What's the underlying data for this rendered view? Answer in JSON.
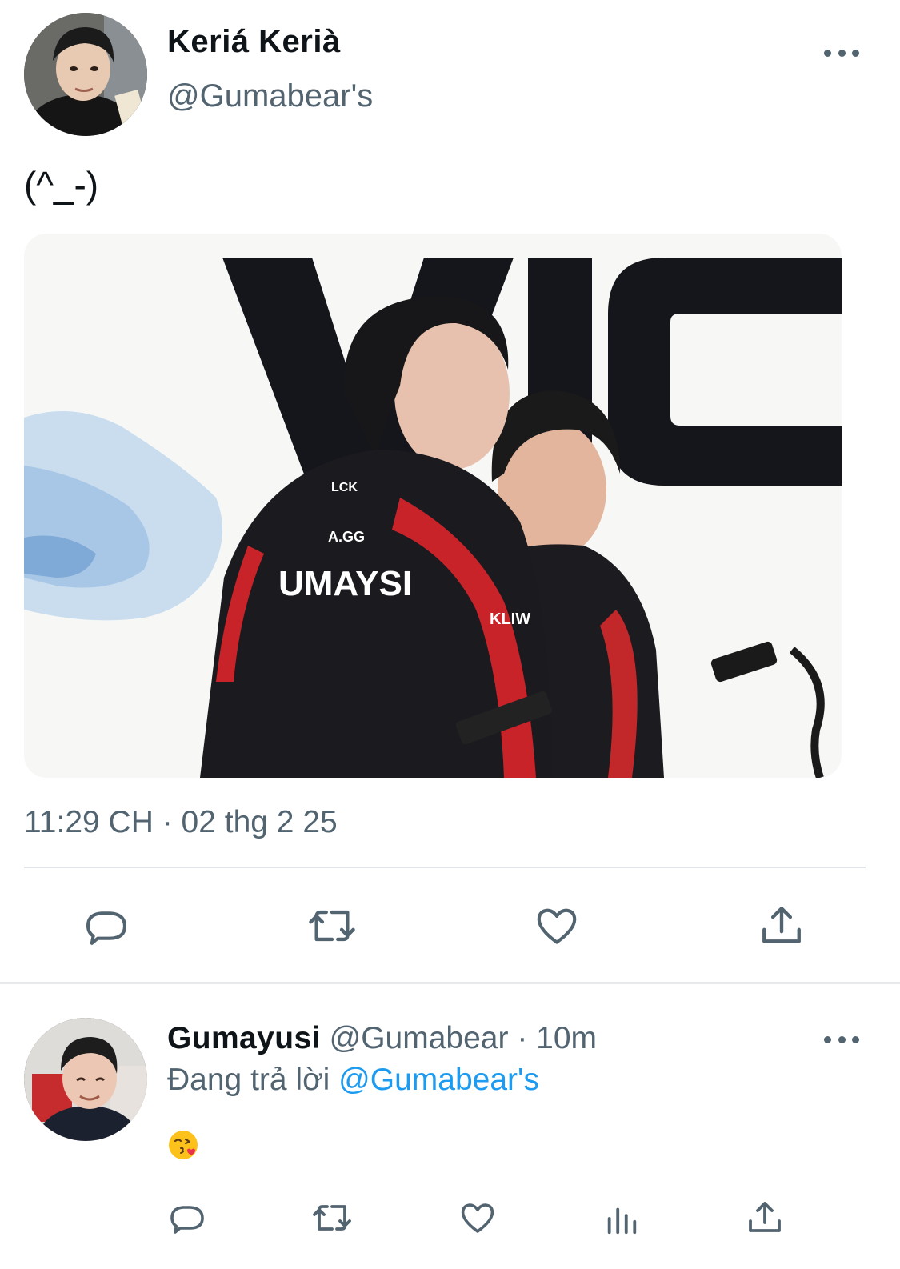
{
  "tweet": {
    "author_name": "Keriá Kerià",
    "author_handle": "@Gumabear's",
    "text": "(^_-)",
    "media": {
      "banner_letters": "VIC",
      "jersey_name": "UMAYSI",
      "sponsor_1": "A.GG",
      "sponsor_2": "KLIW",
      "league": "LCK"
    },
    "timestamp": "11:29 CH · 02 thg 2 25",
    "actions": [
      "reply-icon",
      "retweet-icon",
      "like-icon",
      "share-icon"
    ]
  },
  "reply": {
    "author_name": "Gumayusi",
    "author_handle": "@Gumabear",
    "separator": "·",
    "time": "10m",
    "replying_prefix": "Đang trả lời",
    "replying_to": "@Gumabear's",
    "text_emoji": "face-blowing-a-kiss",
    "actions": [
      "reply-icon",
      "retweet-icon",
      "like-icon",
      "analytics-icon",
      "share-icon"
    ]
  },
  "colors": {
    "text_primary": "#0f1419",
    "text_secondary": "#536471",
    "link": "#1d9bf0",
    "divider": "#e1e5e9"
  }
}
